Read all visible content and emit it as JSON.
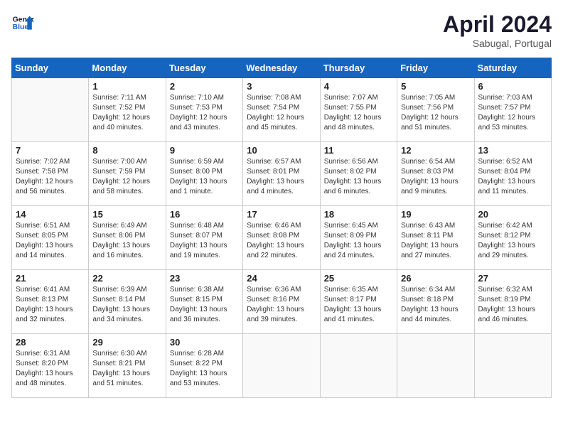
{
  "header": {
    "logo_line1": "General",
    "logo_line2": "Blue",
    "month": "April 2024",
    "location": "Sabugal, Portugal"
  },
  "weekdays": [
    "Sunday",
    "Monday",
    "Tuesday",
    "Wednesday",
    "Thursday",
    "Friday",
    "Saturday"
  ],
  "weeks": [
    [
      {
        "day": "",
        "sunrise": "",
        "sunset": "",
        "daylight": ""
      },
      {
        "day": "1",
        "sunrise": "Sunrise: 7:11 AM",
        "sunset": "Sunset: 7:52 PM",
        "daylight": "Daylight: 12 hours and 40 minutes."
      },
      {
        "day": "2",
        "sunrise": "Sunrise: 7:10 AM",
        "sunset": "Sunset: 7:53 PM",
        "daylight": "Daylight: 12 hours and 43 minutes."
      },
      {
        "day": "3",
        "sunrise": "Sunrise: 7:08 AM",
        "sunset": "Sunset: 7:54 PM",
        "daylight": "Daylight: 12 hours and 45 minutes."
      },
      {
        "day": "4",
        "sunrise": "Sunrise: 7:07 AM",
        "sunset": "Sunset: 7:55 PM",
        "daylight": "Daylight: 12 hours and 48 minutes."
      },
      {
        "day": "5",
        "sunrise": "Sunrise: 7:05 AM",
        "sunset": "Sunset: 7:56 PM",
        "daylight": "Daylight: 12 hours and 51 minutes."
      },
      {
        "day": "6",
        "sunrise": "Sunrise: 7:03 AM",
        "sunset": "Sunset: 7:57 PM",
        "daylight": "Daylight: 12 hours and 53 minutes."
      }
    ],
    [
      {
        "day": "7",
        "sunrise": "Sunrise: 7:02 AM",
        "sunset": "Sunset: 7:58 PM",
        "daylight": "Daylight: 12 hours and 56 minutes."
      },
      {
        "day": "8",
        "sunrise": "Sunrise: 7:00 AM",
        "sunset": "Sunset: 7:59 PM",
        "daylight": "Daylight: 12 hours and 58 minutes."
      },
      {
        "day": "9",
        "sunrise": "Sunrise: 6:59 AM",
        "sunset": "Sunset: 8:00 PM",
        "daylight": "Daylight: 13 hours and 1 minute."
      },
      {
        "day": "10",
        "sunrise": "Sunrise: 6:57 AM",
        "sunset": "Sunset: 8:01 PM",
        "daylight": "Daylight: 13 hours and 4 minutes."
      },
      {
        "day": "11",
        "sunrise": "Sunrise: 6:56 AM",
        "sunset": "Sunset: 8:02 PM",
        "daylight": "Daylight: 13 hours and 6 minutes."
      },
      {
        "day": "12",
        "sunrise": "Sunrise: 6:54 AM",
        "sunset": "Sunset: 8:03 PM",
        "daylight": "Daylight: 13 hours and 9 minutes."
      },
      {
        "day": "13",
        "sunrise": "Sunrise: 6:52 AM",
        "sunset": "Sunset: 8:04 PM",
        "daylight": "Daylight: 13 hours and 11 minutes."
      }
    ],
    [
      {
        "day": "14",
        "sunrise": "Sunrise: 6:51 AM",
        "sunset": "Sunset: 8:05 PM",
        "daylight": "Daylight: 13 hours and 14 minutes."
      },
      {
        "day": "15",
        "sunrise": "Sunrise: 6:49 AM",
        "sunset": "Sunset: 8:06 PM",
        "daylight": "Daylight: 13 hours and 16 minutes."
      },
      {
        "day": "16",
        "sunrise": "Sunrise: 6:48 AM",
        "sunset": "Sunset: 8:07 PM",
        "daylight": "Daylight: 13 hours and 19 minutes."
      },
      {
        "day": "17",
        "sunrise": "Sunrise: 6:46 AM",
        "sunset": "Sunset: 8:08 PM",
        "daylight": "Daylight: 13 hours and 22 minutes."
      },
      {
        "day": "18",
        "sunrise": "Sunrise: 6:45 AM",
        "sunset": "Sunset: 8:09 PM",
        "daylight": "Daylight: 13 hours and 24 minutes."
      },
      {
        "day": "19",
        "sunrise": "Sunrise: 6:43 AM",
        "sunset": "Sunset: 8:11 PM",
        "daylight": "Daylight: 13 hours and 27 minutes."
      },
      {
        "day": "20",
        "sunrise": "Sunrise: 6:42 AM",
        "sunset": "Sunset: 8:12 PM",
        "daylight": "Daylight: 13 hours and 29 minutes."
      }
    ],
    [
      {
        "day": "21",
        "sunrise": "Sunrise: 6:41 AM",
        "sunset": "Sunset: 8:13 PM",
        "daylight": "Daylight: 13 hours and 32 minutes."
      },
      {
        "day": "22",
        "sunrise": "Sunrise: 6:39 AM",
        "sunset": "Sunset: 8:14 PM",
        "daylight": "Daylight: 13 hours and 34 minutes."
      },
      {
        "day": "23",
        "sunrise": "Sunrise: 6:38 AM",
        "sunset": "Sunset: 8:15 PM",
        "daylight": "Daylight: 13 hours and 36 minutes."
      },
      {
        "day": "24",
        "sunrise": "Sunrise: 6:36 AM",
        "sunset": "Sunset: 8:16 PM",
        "daylight": "Daylight: 13 hours and 39 minutes."
      },
      {
        "day": "25",
        "sunrise": "Sunrise: 6:35 AM",
        "sunset": "Sunset: 8:17 PM",
        "daylight": "Daylight: 13 hours and 41 minutes."
      },
      {
        "day": "26",
        "sunrise": "Sunrise: 6:34 AM",
        "sunset": "Sunset: 8:18 PM",
        "daylight": "Daylight: 13 hours and 44 minutes."
      },
      {
        "day": "27",
        "sunrise": "Sunrise: 6:32 AM",
        "sunset": "Sunset: 8:19 PM",
        "daylight": "Daylight: 13 hours and 46 minutes."
      }
    ],
    [
      {
        "day": "28",
        "sunrise": "Sunrise: 6:31 AM",
        "sunset": "Sunset: 8:20 PM",
        "daylight": "Daylight: 13 hours and 48 minutes."
      },
      {
        "day": "29",
        "sunrise": "Sunrise: 6:30 AM",
        "sunset": "Sunset: 8:21 PM",
        "daylight": "Daylight: 13 hours and 51 minutes."
      },
      {
        "day": "30",
        "sunrise": "Sunrise: 6:28 AM",
        "sunset": "Sunset: 8:22 PM",
        "daylight": "Daylight: 13 hours and 53 minutes."
      },
      {
        "day": "",
        "sunrise": "",
        "sunset": "",
        "daylight": ""
      },
      {
        "day": "",
        "sunrise": "",
        "sunset": "",
        "daylight": ""
      },
      {
        "day": "",
        "sunrise": "",
        "sunset": "",
        "daylight": ""
      },
      {
        "day": "",
        "sunrise": "",
        "sunset": "",
        "daylight": ""
      }
    ]
  ]
}
